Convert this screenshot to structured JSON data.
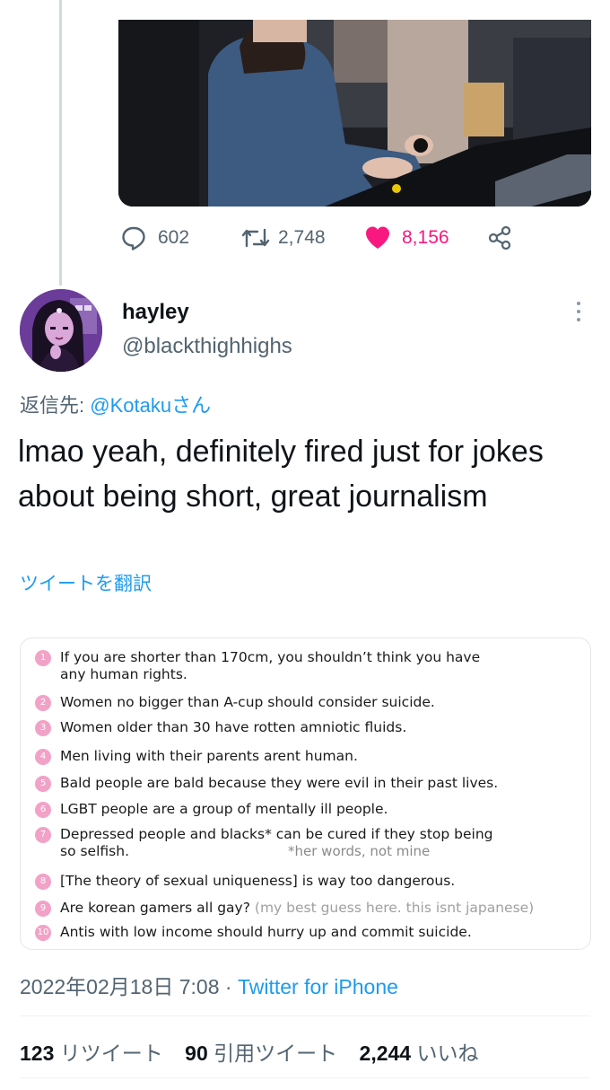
{
  "previous_tweet": {
    "actions": {
      "reply_count": "602",
      "retweet_count": "2,748",
      "like_count": "8,156",
      "like_color": "#f91880"
    }
  },
  "tweet": {
    "display_name": "hayley",
    "handle": "@blackthighhighs",
    "reply_label": "返信先:",
    "reply_target": "@Kotakuさん",
    "text": "lmao yeah, definitely fired just for jokes about being short, great journalism",
    "translate_label": "ツイートを翻訳",
    "image_rules": [
      {
        "num": "1",
        "text": "If you are shorter than 170cm, you shouldn’t think you have",
        "text2": "any human rights."
      },
      {
        "num": "2",
        "text": "Women no bigger than A-cup should consider suicide."
      },
      {
        "num": "3",
        "text": "Women older than 30 have rotten amniotic fluids."
      },
      {
        "num": "4",
        "text": "Men living with their parents arent human."
      },
      {
        "num": "5",
        "text": "Bald people are bald because they were evil in their past lives."
      },
      {
        "num": "6",
        "text": "LGBT people are a group of mentally ill people."
      },
      {
        "num": "7",
        "text": "Depressed people and blacks* can be cured if they stop being",
        "text2": "so selfish."
      },
      {
        "num": "8",
        "text": "[The theory of sexual uniqueness] is way too dangerous."
      },
      {
        "num": "9",
        "text": "Are korean gamers all gay?",
        "note": "(my best guess here. this isnt japanese)"
      },
      {
        "num": "10",
        "text": "Antis with low income should hurry up and commit suicide."
      }
    ],
    "image_side_note": "*her words, not mine",
    "timestamp": "2022年02月18日 7:08",
    "separator": "·",
    "source": "Twitter for iPhone",
    "stats": {
      "retweets": "123",
      "retweets_label": "リツイート",
      "quotes": "90",
      "quotes_label": "引用ツイート",
      "likes": "2,244",
      "likes_label": "いいね"
    }
  },
  "colors": {
    "link": "#1d9bf0",
    "secondary_text": "#536471",
    "rule_badge": "#f2a2c7"
  }
}
